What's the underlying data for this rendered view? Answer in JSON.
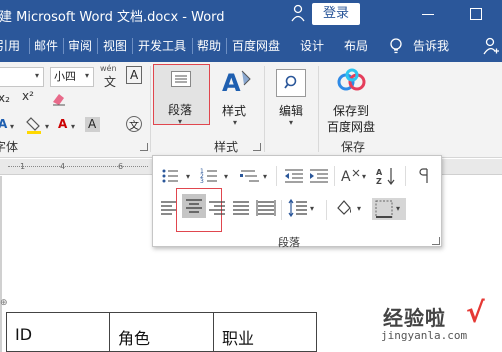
{
  "titlebar": {
    "title": "新建 Microsoft Word 文档.docx  -  Word",
    "login_label": "登录"
  },
  "tabs": [
    "引用",
    "邮件",
    "审阅",
    "视图",
    "开发工具",
    "帮助",
    "百度网盘",
    "设计",
    "布局"
  ],
  "tell_me": "告诉我",
  "ribbon": {
    "font_size": "小四",
    "font_group_label": "字体",
    "paragraph_label": "段落",
    "styles_label": "样式",
    "styles_group_label": "样式",
    "editing_label": "编辑",
    "save_label_line1": "保存到",
    "save_label_line2": "百度网盘",
    "save_group_label": "保存",
    "wen_glyph": "wén",
    "wen_char": "文",
    "char_a": "A",
    "char_x": "X"
  },
  "ruler": [
    "1",
    "4",
    "6"
  ],
  "popup": {
    "label": "段落"
  },
  "table": {
    "headers": [
      "ID",
      "角色",
      "职业"
    ]
  },
  "watermark": {
    "text": "经验啦",
    "url": "jingyanla.com"
  },
  "colors": {
    "titlebar": "#2b579a",
    "highlight": "#e0464e",
    "ribbon": "#f3f3f3"
  }
}
